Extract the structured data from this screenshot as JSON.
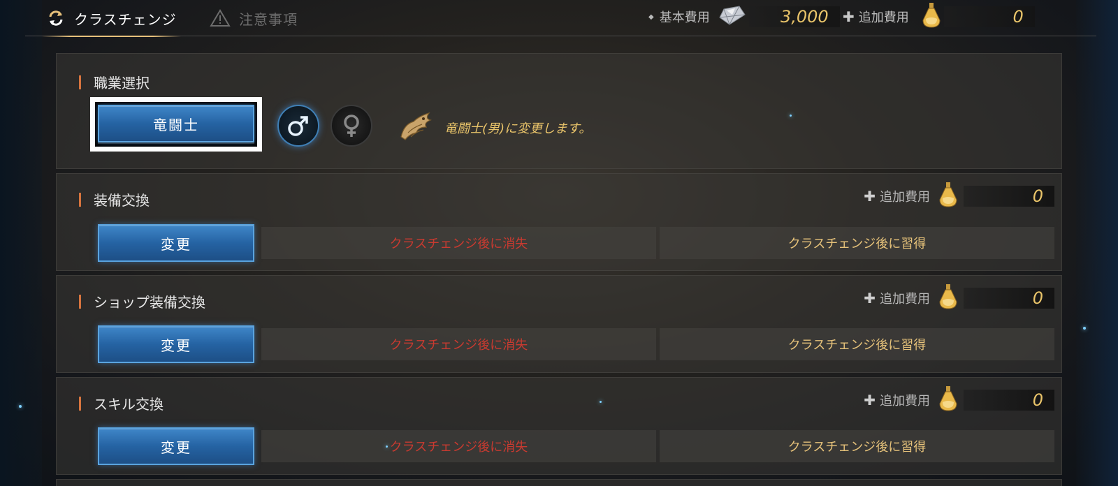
{
  "header": {
    "tabs": [
      {
        "label": "クラスチェンジ",
        "active": true,
        "icon": "refresh-icon"
      },
      {
        "label": "注意事項",
        "active": false,
        "icon": "warning-icon"
      }
    ],
    "base_cost": {
      "label": "基本費用",
      "icon": "crystal-icon",
      "value": "3,000"
    },
    "additional_cost": {
      "label": "追加費用",
      "icon": "potion-icon",
      "value": "0"
    }
  },
  "job_select": {
    "title": "職業選択",
    "job_button": "竜闘士",
    "genders": [
      {
        "symbol": "♂",
        "selected": true,
        "icon": "male-icon"
      },
      {
        "symbol": "♀",
        "selected": false,
        "icon": "female-icon"
      }
    ],
    "note_icon": "dragon-emblem-icon",
    "note": "竜闘士(男)に変更します。"
  },
  "sections": [
    {
      "title": "装備交換",
      "button": "変更",
      "lose_label": "クラスチェンジ後に消失",
      "gain_label": "クラスチェンジ後に習得",
      "additional_cost_label": "追加費用",
      "additional_cost": "0"
    },
    {
      "title": "ショップ装備交換",
      "button": "変更",
      "lose_label": "クラスチェンジ後に消失",
      "gain_label": "クラスチェンジ後に習得",
      "additional_cost_label": "追加費用",
      "additional_cost": "0"
    },
    {
      "title": "スキル交換",
      "button": "変更",
      "lose_label": "クラスチェンジ後に消失",
      "gain_label": "クラスチェンジ後に習得",
      "additional_cost_label": "追加費用",
      "additional_cost": "0"
    }
  ],
  "colors": {
    "accent_gold": "#e9c46a",
    "lose_red": "#c93a30",
    "button_blue": "#2563a3",
    "title_bar_orange": "#d6743e"
  }
}
